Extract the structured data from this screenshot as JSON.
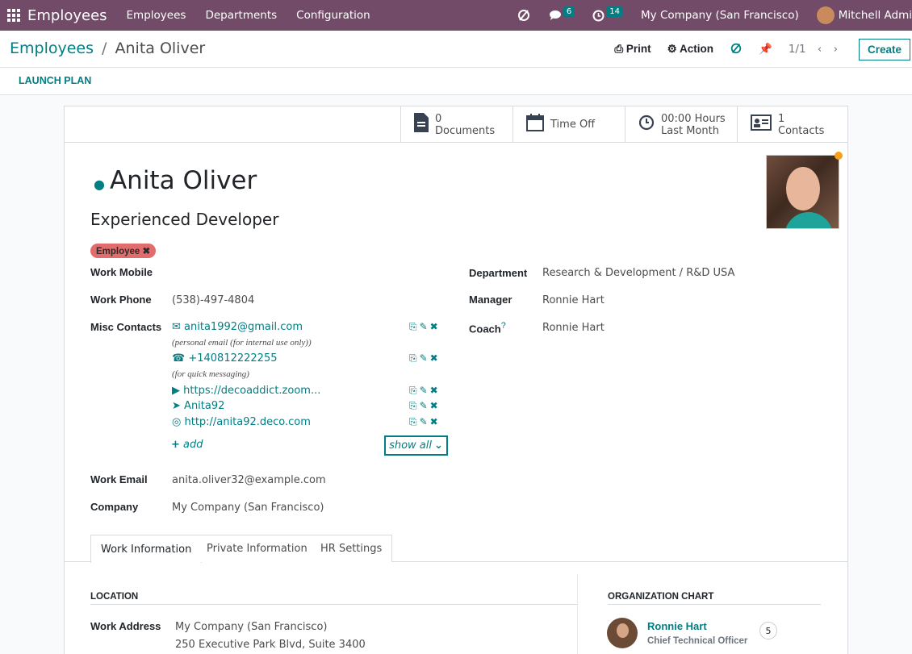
{
  "topbar": {
    "brand": "Employees",
    "nav": [
      "Employees",
      "Departments",
      "Configuration"
    ],
    "messages_count": "6",
    "activities_count": "14",
    "company": "My Company (San Francisco)",
    "user": "Mitchell Admi"
  },
  "breadcrumb": {
    "parent": "Employees",
    "separator": "/",
    "current": "Anita Oliver"
  },
  "controls": {
    "print": "Print",
    "action": "Action",
    "pager": "1/1",
    "create": "Create"
  },
  "statusbar": {
    "launch_plan": "LAUNCH PLAN"
  },
  "smart_buttons": {
    "documents_count": "0",
    "documents_label": "Documents",
    "timeoff_label": "Time Off",
    "hours_value": "00:00 Hours",
    "hours_label": "Last Month",
    "contacts_count": "1",
    "contacts_label": "Contacts"
  },
  "employee": {
    "name": "Anita Oliver",
    "job_title": "Experienced Developer",
    "tag": "Employee"
  },
  "fields": {
    "work_mobile_label": "Work Mobile",
    "work_phone_label": "Work Phone",
    "work_phone": "(538)-497-4804",
    "misc_contacts_label": "Misc Contacts",
    "work_email_label": "Work Email",
    "work_email": "anita.oliver32@example.com",
    "company_label": "Company",
    "company": "My Company (San Francisco)",
    "department_label": "Department",
    "department": "Research & Development / R&D USA",
    "manager_label": "Manager",
    "manager": "Ronnie Hart",
    "coach_label": "Coach",
    "coach_help": "?",
    "coach": "Ronnie Hart"
  },
  "misc_contacts": [
    {
      "icon": "envelope-icon",
      "value": "anita1992@gmail.com",
      "note": "(personal email (for internal use only))"
    },
    {
      "icon": "whatsapp-icon",
      "value": "+140812222255",
      "note": "(for quick messaging)"
    },
    {
      "icon": "video-icon",
      "value": "https://decoaddict.zoom..."
    },
    {
      "icon": "telegram-icon",
      "value": "Anita92"
    },
    {
      "icon": "globe-icon",
      "value": "http://anita92.deco.com"
    }
  ],
  "misc_actions": {
    "add": "add",
    "show_all": "show all"
  },
  "tabs": [
    "Work Information",
    "Private Information",
    "HR Settings"
  ],
  "work_info": {
    "location_title": "LOCATION",
    "work_address_label": "Work Address",
    "work_address_line1": "My Company (San Francisco)",
    "work_address_line2": "250 Executive Park Blvd, Suite 3400"
  },
  "org_chart": {
    "title": "ORGANIZATION CHART",
    "manager_name": "Ronnie Hart",
    "manager_title": "Chief Technical Officer",
    "count": "5"
  },
  "colors": {
    "brand": "#714b67",
    "accent": "#017e84",
    "tag": "#e26b6b",
    "status_dot": "#f7a01a"
  }
}
